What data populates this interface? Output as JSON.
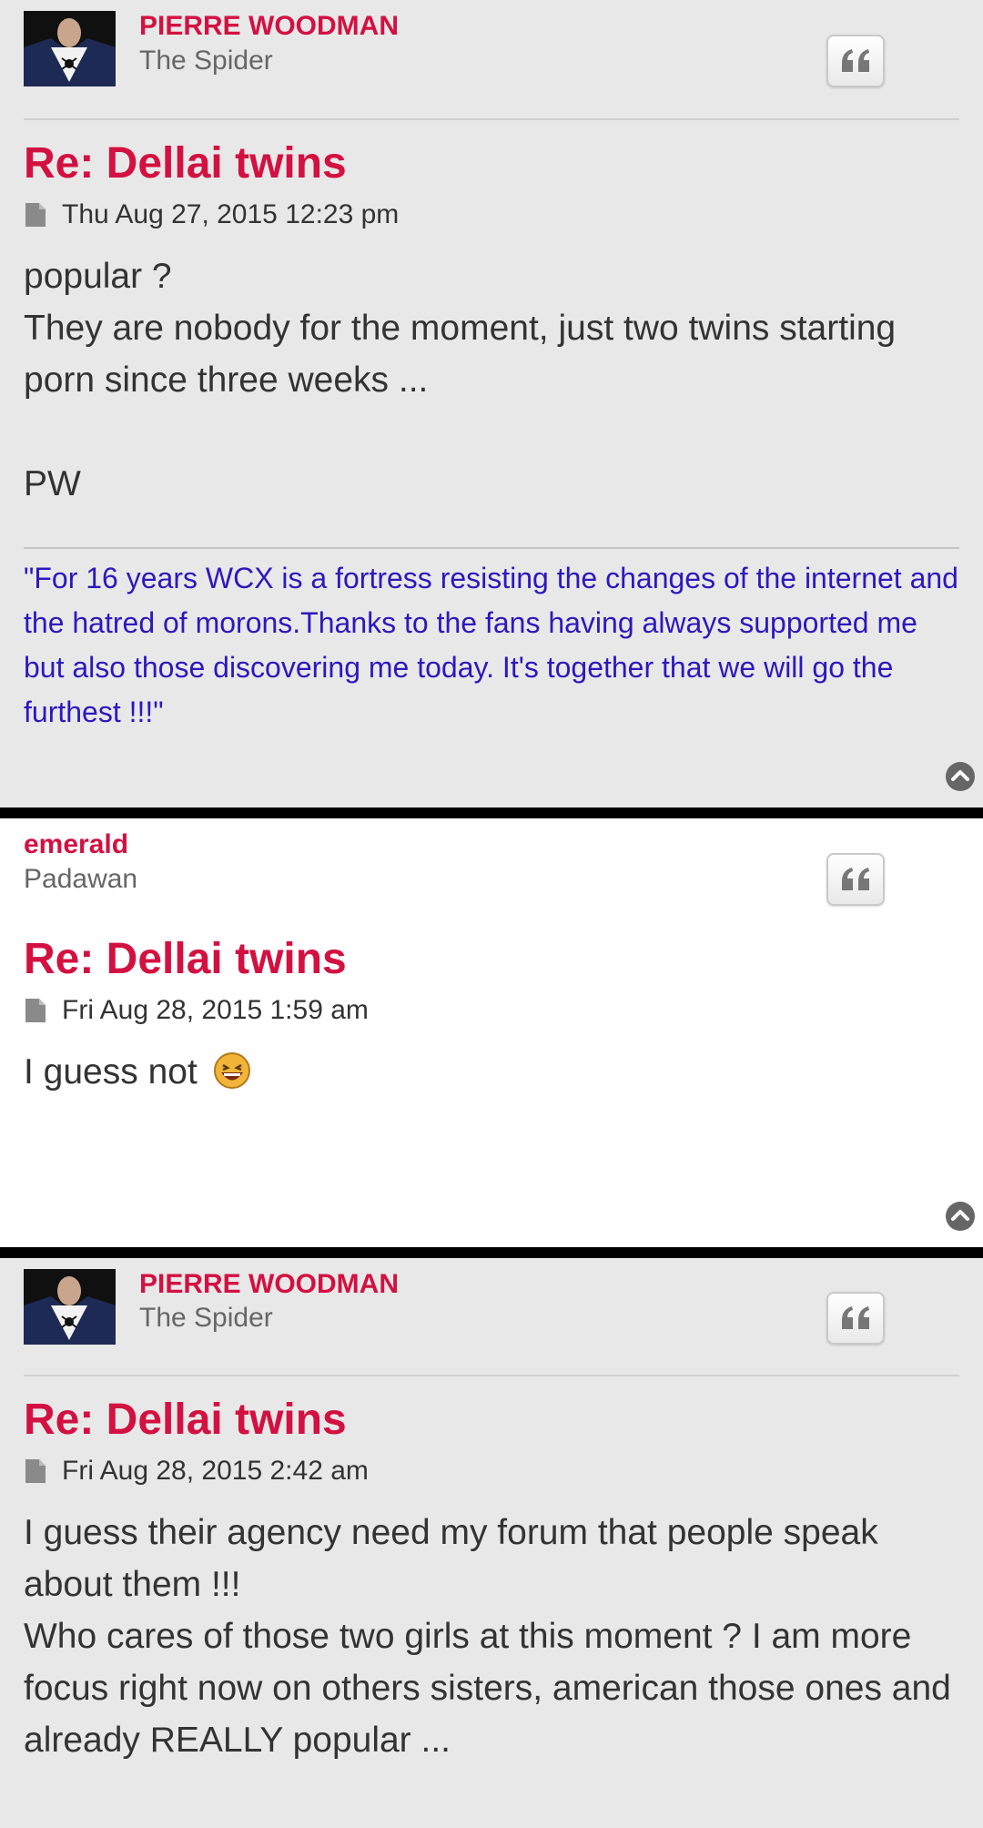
{
  "posts": [
    {
      "author": "PIERRE WOODMAN",
      "rank": "The Spider",
      "title": "Re: Dellai twins",
      "date": "Thu Aug 27, 2015 12:23 pm",
      "lines": [
        "popular ?",
        "They are nobody for the moment, just two twins starting porn since three weeks ...",
        "",
        "PW"
      ],
      "signature": "\"For 16 years WCX is a fortress resisting the changes of the internet and the hatred of morons.Thanks to the fans having always supported me but also those discovering me today. It's together that we will go the furthest !!!\""
    },
    {
      "author": "emerald",
      "rank": "Padawan",
      "title": "Re: Dellai twins",
      "date": "Fri Aug 28, 2015 1:59 am",
      "text": "I guess not"
    },
    {
      "author": "PIERRE WOODMAN",
      "rank": "The Spider",
      "title": "Re: Dellai twins",
      "date": "Fri Aug 28, 2015 2:42 am",
      "lines": [
        "I guess their agency need my forum that people speak about them !!!",
        "Who cares of those two girls at this moment ? I am more focus right now on others sisters, american those ones and already REALLY popular ..."
      ]
    }
  ],
  "colors": {
    "author": "#d31141",
    "title": "#d31141",
    "signature": "#2d18bd",
    "separator": "#000000"
  },
  "icons": {
    "quote": "quote-icon",
    "post": "document-icon",
    "top": "chevron-up-circle-icon",
    "emoji": "laughing-emoji-icon"
  }
}
